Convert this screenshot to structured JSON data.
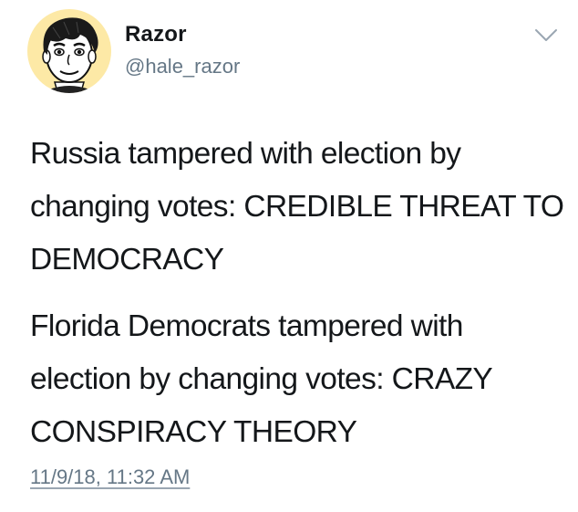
{
  "user": {
    "display_name": "Razor",
    "handle": "@hale_razor",
    "avatar_icon": "cartoon-face-avatar-icon"
  },
  "menu": {
    "icon": "chevron-down-icon"
  },
  "tweet": {
    "paragraphs": [
      "Russia tampered with election by changing votes: CREDIBLE THREAT TO DEMOCRACY",
      "Florida Democrats tampered with election by changing votes: CRAZY CONSPIRACY THEORY"
    ],
    "timestamp": "11/9/18, 11:32 AM"
  },
  "colors": {
    "text": "#14171a",
    "secondary": "#657786",
    "avatar_bg": "#fde9a6",
    "background": "#ffffff"
  }
}
